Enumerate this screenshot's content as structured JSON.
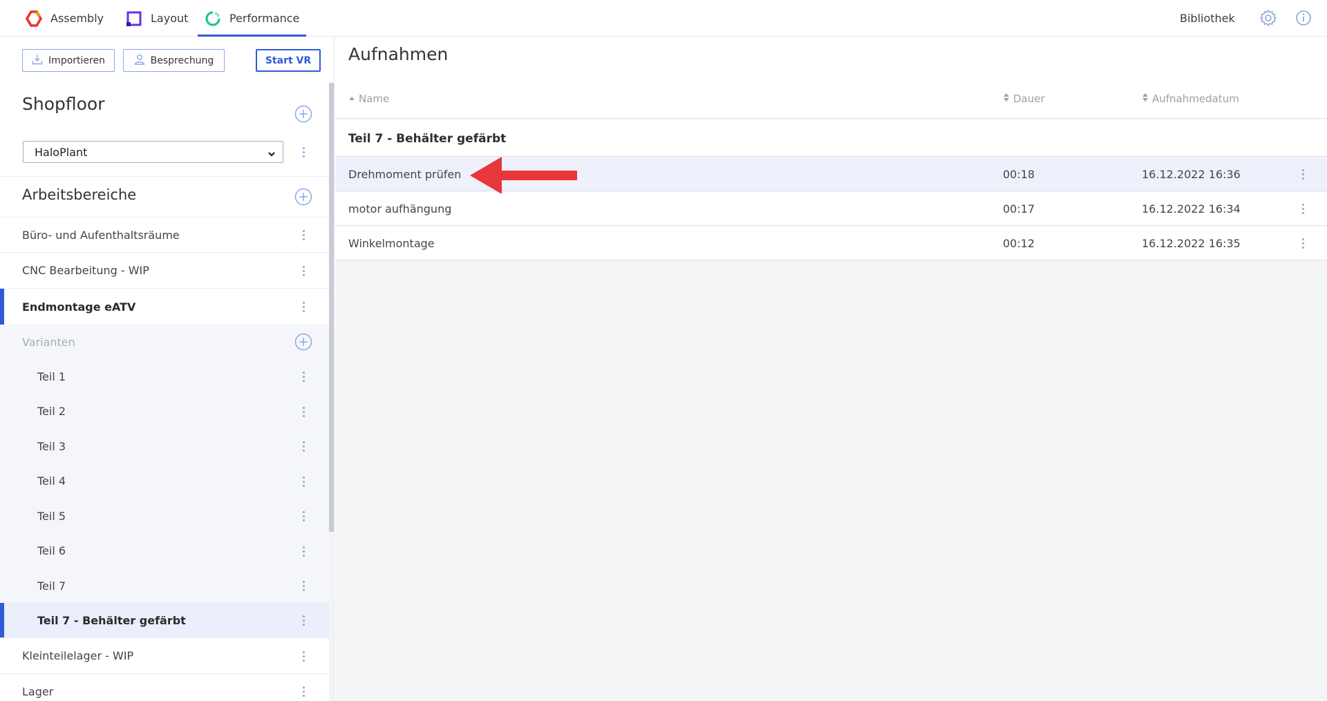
{
  "topnav": {
    "tabs": [
      {
        "label": "Assembly",
        "active": false,
        "icon": "assembly-hexagon-icon",
        "color": "#e8322c"
      },
      {
        "label": "Layout",
        "active": false,
        "icon": "layout-square-icon",
        "color": "#6a2ee8"
      },
      {
        "label": "Performance",
        "active": true,
        "icon": "performance-circle-icon",
        "color": "#23c48e"
      }
    ],
    "library_label": "Bibliothek",
    "icons": [
      "gear-icon",
      "info-icon"
    ]
  },
  "sidebar": {
    "buttons": {
      "import_label": "Importieren",
      "meeting_label": "Besprechung",
      "vr_label": "Start VR"
    },
    "shopfloor": {
      "title": "Shopfloor",
      "selected_plant": "HaloPlant"
    },
    "workspaces": {
      "title": "Arbeitsbereiche",
      "items": [
        {
          "label": "Büro- und Aufenthaltsräume"
        },
        {
          "label": "CNC Bearbeitung - WIP"
        },
        {
          "label": "Endmontage eATV",
          "active": true
        }
      ],
      "variants_label": "Varianten",
      "variants": [
        {
          "label": "Teil 1"
        },
        {
          "label": "Teil 2"
        },
        {
          "label": "Teil 3"
        },
        {
          "label": "Teil 4"
        },
        {
          "label": "Teil 5"
        },
        {
          "label": "Teil 6"
        },
        {
          "label": "Teil 7"
        },
        {
          "label": "Teil 7 - Behälter gefärbt",
          "active": true
        }
      ],
      "more_items": [
        {
          "label": "Kleinteilelager - WIP"
        },
        {
          "label": "Lager"
        }
      ]
    }
  },
  "main": {
    "title": "Aufnahmen",
    "columns": {
      "name": "Name",
      "duration": "Dauer",
      "date": "Aufnahmedatum"
    },
    "group_title": "Teil 7 - Behälter gefärbt",
    "recordings": [
      {
        "name": "Drehmoment prüfen",
        "duration": "00:18",
        "date": "16.12.2022 16:36",
        "highlighted": true
      },
      {
        "name": "motor aufhängung",
        "duration": "00:17",
        "date": "16.12.2022 16:34",
        "highlighted": false
      },
      {
        "name": "Winkelmontage",
        "duration": "00:12",
        "date": "16.12.2022 16:35",
        "highlighted": false
      }
    ],
    "annotation": {
      "icon": "red-arrow-icon",
      "color": "#e8363a"
    }
  },
  "colors": {
    "accent": "#2f5bd8",
    "selected_row": "#ebeefb",
    "kebab": "#8da5dc"
  }
}
